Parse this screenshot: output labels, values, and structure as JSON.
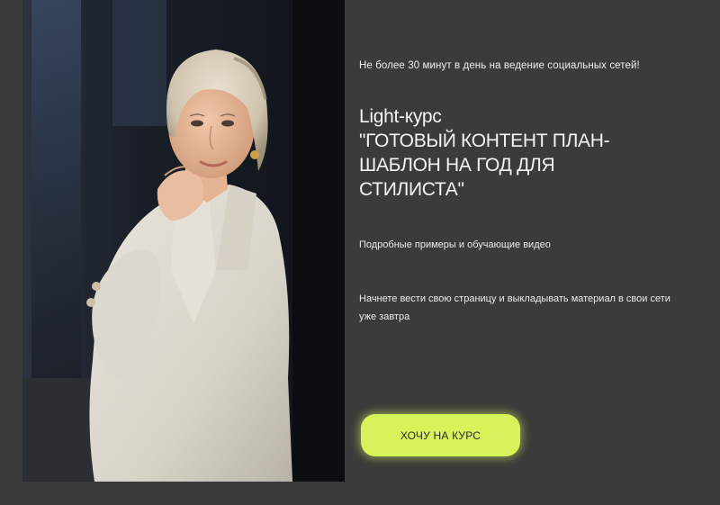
{
  "hero": {
    "photo_icon": "portrait-photo",
    "tagline": "Не более 30 минут в день на ведение социальных сетей!",
    "title_lines": [
      "Light-курс",
      "\"ГОТОВЫЙ КОНТЕНТ ПЛАН-",
      "ШАБЛОН НА ГОД ДЛЯ",
      "СТИЛИСТА\""
    ],
    "description_1": "Подробные примеры и обучающие видео",
    "description_2": "Начнете вести  свою страницу и выкладывать материал в свои сети уже завтра",
    "cta_label": "ХОЧУ НА КУРС"
  },
  "colors": {
    "background": "#3b3b3b",
    "accent": "#d7f35c",
    "text": "#f2f2f2"
  }
}
